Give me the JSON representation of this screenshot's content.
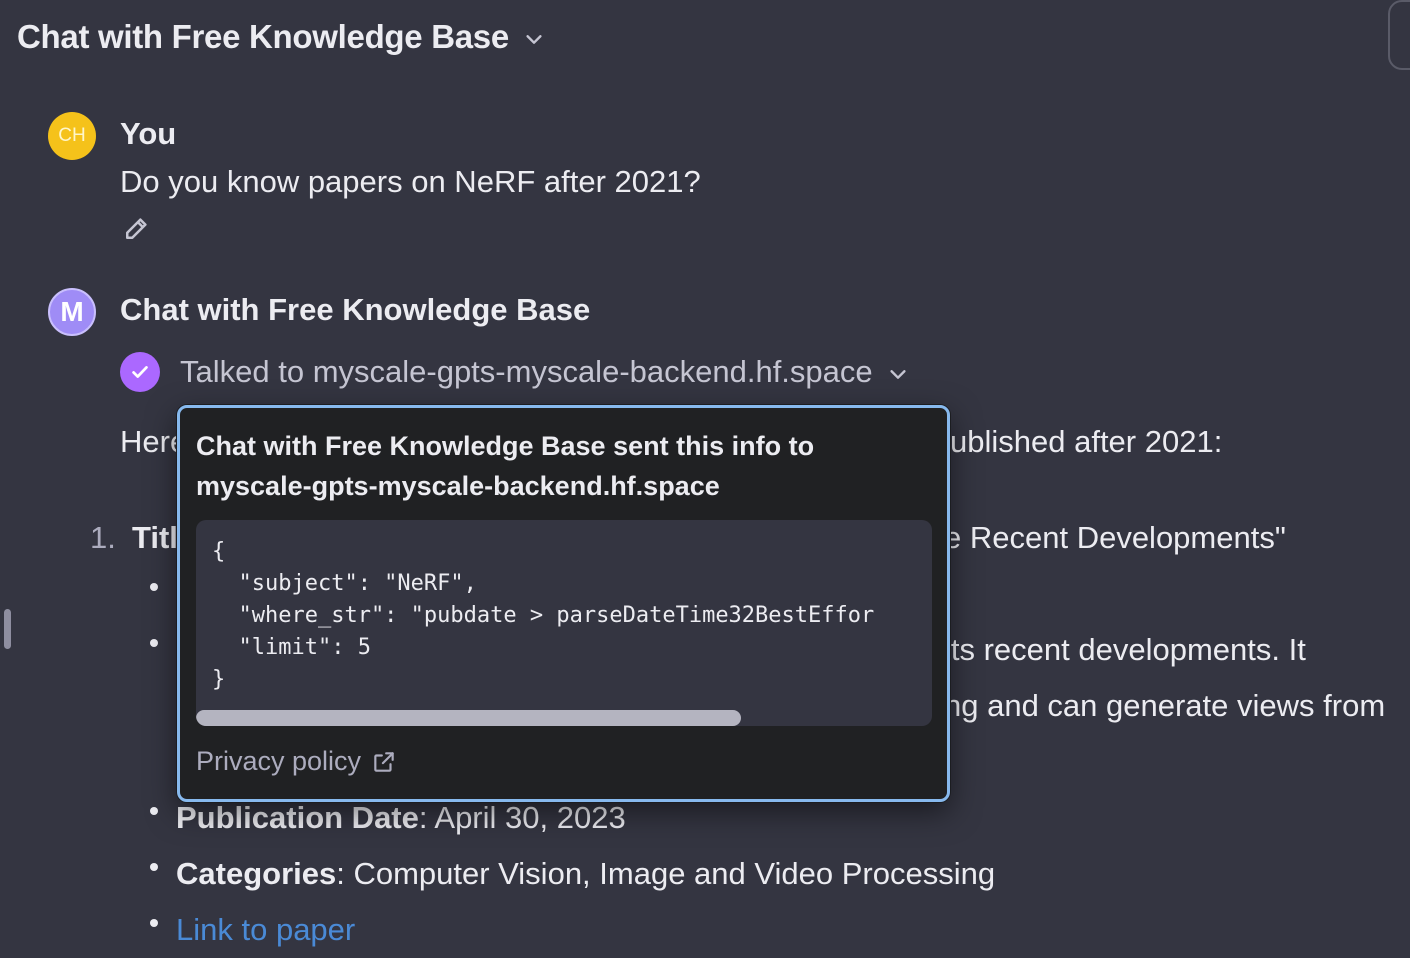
{
  "header": {
    "title": "Chat with Free Knowledge Base"
  },
  "user_message": {
    "avatar_initials": "CH",
    "author": "You",
    "text": "Do you know papers on NeRF after 2021?"
  },
  "assistant_message": {
    "avatar_initial": "M",
    "author": "Chat with Free Knowledge Base",
    "tool_status": "Talked to myscale-gpts-myscale-backend.hf.space",
    "intro_prefix": "Here",
    "intro_suffix": "ublished after 2021:",
    "item_number": "1.",
    "item_title_prefix": "Titl",
    "item_title_suffix": "e Recent Developments\"",
    "desc_fragment_1": "its recent developments. It",
    "desc_fragment_2": "ng and can generate views from",
    "publication_label": "Publication Date",
    "publication_value": ": April 30, 2023",
    "categories_label": "Categories",
    "categories_value": ": Computer Vision, Image and Video Processing",
    "link_text": "Link to paper"
  },
  "popover": {
    "title": "Chat with Free Knowledge Base sent this info to myscale-gpts-myscale-backend.hf.space",
    "code": "{\n  \"subject\": \"NeRF\",\n  \"where_str\": \"pubdate > parseDateTime32BestEffor\n  \"limit\": 5\n}",
    "privacy_label": "Privacy policy",
    "scroll_fraction": 0.74
  },
  "colors": {
    "background": "#343541",
    "user_avatar": "#f5c21a",
    "bot_avatar": "#9f8cf6",
    "check": "#ab68ff",
    "popover_border": "#87b9ee",
    "link": "#4a8ad6"
  }
}
